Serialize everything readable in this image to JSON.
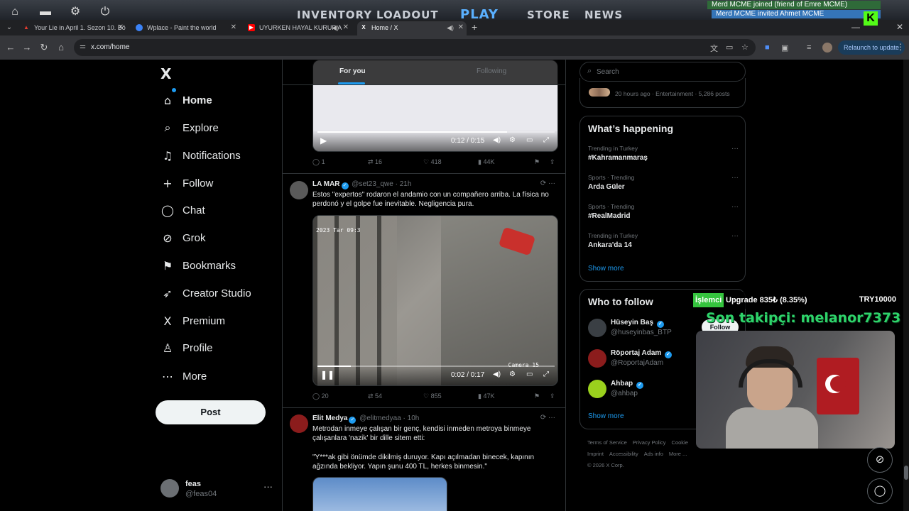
{
  "game": {
    "nav": [
      "INVENTORY",
      "LOADOUT",
      "PLAY",
      "STORE",
      "NEWS"
    ],
    "notifications": [
      "Merd MCME joined (friend of Emre MCME)",
      "Merd MCME invited Ahmet MCME"
    ],
    "badge": "K"
  },
  "browser": {
    "tabs": [
      {
        "title": "Your Lie in April 1. Sezon 10. Bö",
        "color": "#e33b2e"
      },
      {
        "title": "Wplace - Paint the world",
        "color": "#3b82f6"
      },
      {
        "title": "UYURKEN HAYAL KURUP A",
        "color": "#ff0000"
      },
      {
        "title": "Home / X",
        "color": "#000000"
      }
    ],
    "url": "x.com/home",
    "relaunch": "Relaunch to update"
  },
  "nav": {
    "items": [
      {
        "label": "Home",
        "icon": "⌂"
      },
      {
        "label": "Explore",
        "icon": "⌕"
      },
      {
        "label": "Notifications",
        "icon": "♫"
      },
      {
        "label": "Follow",
        "icon": "+"
      },
      {
        "label": "Chat",
        "icon": "◯"
      },
      {
        "label": "Grok",
        "icon": "⊘"
      },
      {
        "label": "Bookmarks",
        "icon": "⚑"
      },
      {
        "label": "Creator Studio",
        "icon": "➶"
      },
      {
        "label": "Premium",
        "icon": "X"
      },
      {
        "label": "Profile",
        "icon": "♙"
      },
      {
        "label": "More",
        "icon": "⋯"
      }
    ],
    "post": "Post",
    "user": {
      "name": "feas",
      "handle": "@feas04"
    }
  },
  "feed": {
    "tabs": [
      "For you",
      "Following"
    ],
    "video1": {
      "time": "0:12 / 0:15",
      "progress": 0.8
    },
    "actions1": {
      "replies": "1",
      "reposts": "16",
      "likes": "418",
      "views": "44K"
    },
    "tweet2": {
      "name": "LA MAR",
      "handle": "@set23_qwe",
      "time": "21h",
      "text": "Estos \"expertos\" rodaron el andamio con un compañero arriba. La física no perdonó y el golpe fue inevitable. Negligencia pura.",
      "cam_stamp": "2023 Tar 09:3",
      "cam_label": "Camera 15",
      "time_label": "0:02 / 0:17",
      "progress": 0.14,
      "replies": "20",
      "reposts": "54",
      "likes": "855",
      "views": "47K"
    },
    "tweet3": {
      "name": "Elit Medya",
      "handle": "@elitmedyaa",
      "time": "10h",
      "text1": "Metrodan inmeye çalışan bir genç, kendisi inmeden metroya binmeye çalışanlara 'nazik' bir dille sitem etti:",
      "text2": "\"Y***ak gibi önümde dikilmiş duruyor. Kapı açılmadan binecek, kapının ağzında bekliyor. Yapın şunu 400 TL, herkes binmesin.\""
    }
  },
  "right": {
    "search_placeholder": "Search",
    "top_meta": "20 hours ago · Entertainment · 5,286 posts",
    "happening": {
      "title": "What’s happening",
      "trends": [
        {
          "context": "Trending in Turkey",
          "name": "#Kahramanmaraş"
        },
        {
          "context": "Sports · Trending",
          "name": "Arda Güler"
        },
        {
          "context": "Sports · Trending",
          "name": "#RealMadrid"
        },
        {
          "context": "Trending in Turkey",
          "name": "Ankara'da 14"
        }
      ],
      "show_more": "Show more"
    },
    "who": {
      "title": "Who to follow",
      "accounts": [
        {
          "name": "Hüseyin Baş",
          "handle": "@huseyinbas_BTP",
          "color": "#3a3f44"
        },
        {
          "name": "Röportaj Adam",
          "handle": "@RoportajAdam",
          "color": "#8b1c1c"
        },
        {
          "name": "Ahbap",
          "handle": "@ahbap",
          "color": "#9ad11d"
        }
      ],
      "follow": "Follow",
      "show_more": "Show more"
    },
    "footer": [
      "Terms of Service",
      "Privacy Policy",
      "Cookie",
      "Imprint",
      "Accessibility",
      "Ads info",
      "More ...",
      "© 2026 X Corp."
    ]
  },
  "overlay": {
    "tag": "İşlemci",
    "sub_text": "Upgrade   835₺ (8.35%)",
    "goal": "TRY10000",
    "follower": "Son takipçi: melanor7373",
    "sub_progress": 0.0835
  }
}
